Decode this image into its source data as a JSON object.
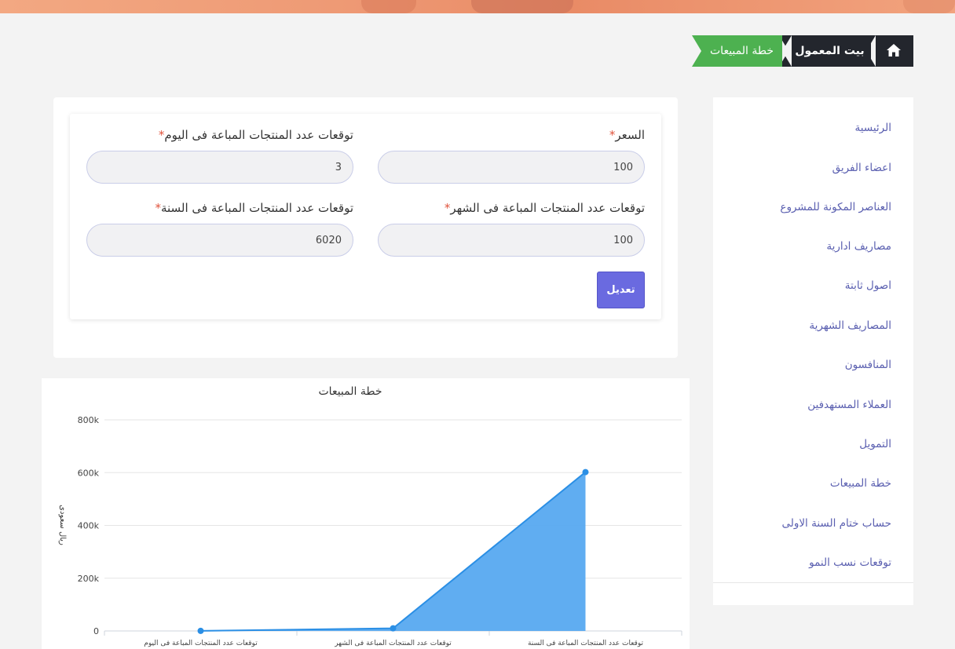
{
  "breadcrumb": {
    "home_icon": "home-icon",
    "items": [
      "بيت المعمول",
      "خطة المبيعات"
    ]
  },
  "sidebar": {
    "items": [
      "الرئيسية",
      "اعضاء الفريق",
      "العناصر المكونة للمشروع",
      "مصاريف ادارية",
      "اصول ثابتة",
      "المصاريف الشهرية",
      "المنافسون",
      "العملاء المستهدفين",
      "التمويل",
      "خطة المبيعات",
      "حساب ختام السنة الاولى",
      "توقعات نسب النمو"
    ]
  },
  "form": {
    "price_label": "السعر",
    "price_value": "100",
    "daily_label": "توقعات عدد المنتجات المباعة فى اليوم",
    "daily_value": "3",
    "monthly_label": "توقعات عدد المنتجات المباعة فى الشهر",
    "monthly_value": "100",
    "yearly_label": "توقعات عدد المنتجات المباعة فى السنة",
    "yearly_value": "6020",
    "required_mark": "*",
    "submit_label": "تعديل"
  },
  "colors": {
    "accent": "#6a6ae0",
    "breadcrumb_dark": "#23262d",
    "breadcrumb_active": "#4db150",
    "chart_fill": "#57a9f0",
    "chart_line": "#2b8fe5"
  },
  "chart_data": {
    "type": "area",
    "title": "خطة المبيعات",
    "ylabel": "ريال سعودى",
    "xlabel": "",
    "categories": [
      "توقعات عدد المنتجات المباعة فى اليوم",
      "توقعات عدد المنتجات المباعة فى الشهر",
      "توقعات عدد المنتجات المباعة فى السنة"
    ],
    "values": [
      300,
      10000,
      602000
    ],
    "ylim": [
      0,
      800000
    ],
    "yticks": [
      0,
      200000,
      400000,
      600000,
      800000
    ],
    "ytick_labels": [
      "0",
      "200k",
      "400k",
      "600k",
      "800k"
    ],
    "grid": true
  }
}
